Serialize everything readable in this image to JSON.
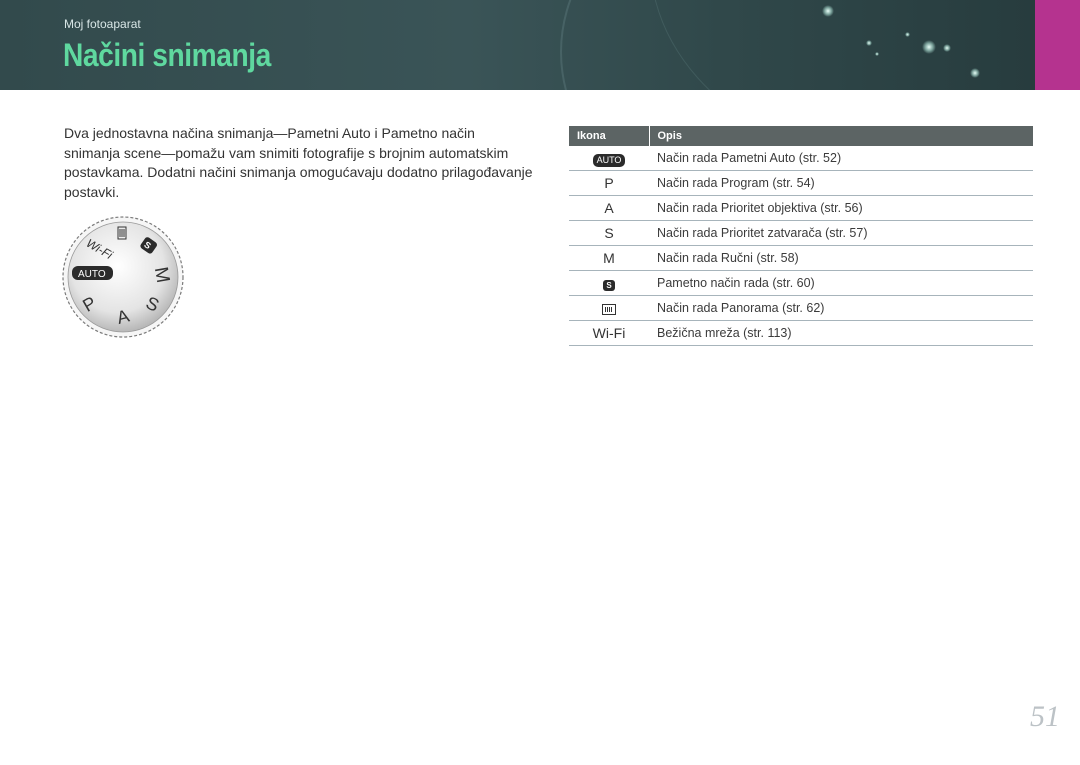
{
  "header": {
    "breadcrumb": "Moj fotoaparat",
    "title": "Načini snimanja",
    "title_color": "#5fd89f",
    "accent_color": "#b5338f"
  },
  "intro_text": "Dva jednostavna načina snimanja—Pametni Auto i Pametno način snimanja scene—pomažu vam snimiti fotografije s brojnim automatskim postavkama. Dodatni načini snimanja omogućavaju dodatno prilagođavanje postavki.",
  "dial": {
    "labels": [
      "Wi-Fi",
      "AUTO",
      "P",
      "A",
      "S",
      "M"
    ],
    "icons": [
      "panorama-icon",
      "smart-mode-icon"
    ]
  },
  "table": {
    "headers": [
      "Ikona",
      "Opis"
    ],
    "rows": [
      {
        "icon": "AUTO",
        "icon_name": "auto-mode-icon",
        "desc": "Način rada Pametni Auto (str. 52)"
      },
      {
        "icon": "P",
        "icon_name": "program-mode-icon",
        "desc": "Način rada Program (str. 54)"
      },
      {
        "icon": "A",
        "icon_name": "aperture-priority-icon",
        "desc": "Način rada Prioritet objektiva (str. 56)"
      },
      {
        "icon": "S",
        "icon_name": "shutter-priority-icon",
        "desc": "Način rada Prioritet zatvarača (str. 57)"
      },
      {
        "icon": "M",
        "icon_name": "manual-mode-icon",
        "desc": "Način rada Ručni (str. 58)"
      },
      {
        "icon": "S",
        "icon_name": "smart-mode-icon",
        "desc": "Pametno način rada (str. 60)"
      },
      {
        "icon": "",
        "icon_name": "panorama-icon",
        "desc": "Način rada Panorama (str. 62)"
      },
      {
        "icon": "Wi-Fi",
        "icon_name": "wifi-mode-icon",
        "desc": "Bežična mreža (str. 113)"
      }
    ]
  },
  "page_number": "51"
}
